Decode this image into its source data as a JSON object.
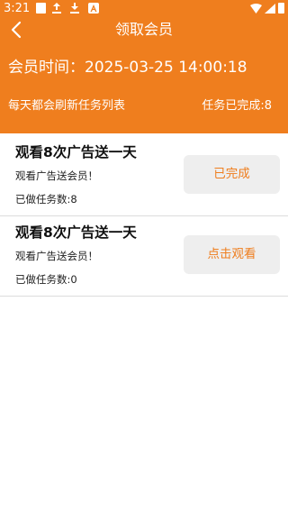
{
  "status_bar": {
    "time": "3:21",
    "icons": [
      "square-notification-icon",
      "upload-icon",
      "download-icon",
      "a-app-icon",
      "wifi-icon",
      "signal-icon",
      "battery-icon"
    ]
  },
  "header": {
    "back_icon": "chevron-left-icon",
    "title": "领取会员",
    "membership_time": "会员时间：2025-03-25 14:00:18",
    "refresh_note": "每天都会刷新任务列表",
    "tasks_completed": "任务已完成:8"
  },
  "tasks": [
    {
      "title": "观看8次广告送一天",
      "description": "观看广告送会员！",
      "done_count": "已做任务数:8",
      "button_label": "已完成"
    },
    {
      "title": "观看8次广告送一天",
      "description": "观看广告送会员！",
      "done_count": "已做任务数:0",
      "button_label": "点击观看"
    }
  ],
  "colors": {
    "accent": "#ef7e1e",
    "button_bg": "#eeeeee",
    "divider": "#dcdcdc"
  }
}
